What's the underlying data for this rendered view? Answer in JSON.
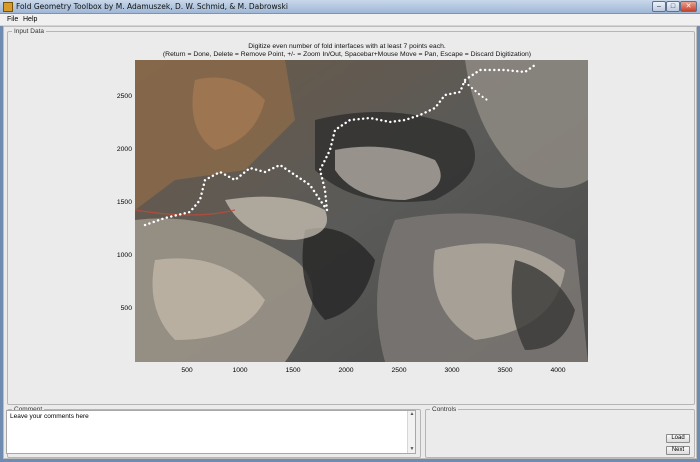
{
  "window": {
    "title": "Fold Geometry Toolbox by M. Adamuszek, D. W. Schmid, & M. Dabrowski",
    "minimize_glyph": "–",
    "maximize_glyph": "□",
    "close_glyph": "✕"
  },
  "menu": {
    "items": [
      "File",
      "Help"
    ]
  },
  "input_panel": {
    "legend": "Input Data",
    "instruction_line1": "Digitize even number of fold interfaces with at least 7 points each.",
    "instruction_line2": "(Return = Done, Delete = Remove Point, +/- = Zoom In/Out, Spacebar+Mouse Move = Pan, Escape = Discard Digitization)"
  },
  "axes": {
    "y_ticks": [
      "2500",
      "2000",
      "1500",
      "1000",
      "500"
    ],
    "x_ticks": [
      "500",
      "1000",
      "1500",
      "2000",
      "2500",
      "3000",
      "3500",
      "4000"
    ]
  },
  "comment_panel": {
    "legend": "Comment",
    "text": "Leave your comments here"
  },
  "controls_panel": {
    "legend": "Controls",
    "load_label": "Load",
    "next_label": "Next"
  },
  "icons": {
    "app": "app-icon",
    "scroll_up": "chevron-up-icon",
    "scroll_down": "chevron-down-icon"
  }
}
